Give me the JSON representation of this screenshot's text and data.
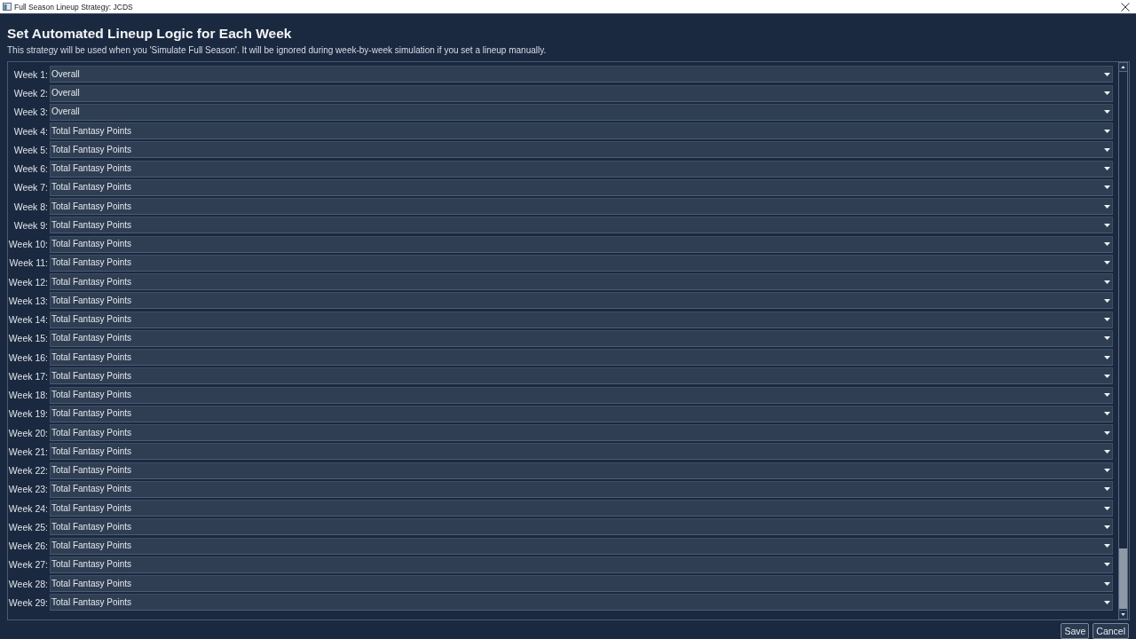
{
  "window": {
    "title": "Full Season Lineup Strategy: JCDS"
  },
  "heading": "Set Automated Lineup Logic for Each Week",
  "description": "This strategy will be used when you 'Simulate Full Season'. It will be ignored during week-by-week simulation if you set a lineup manually.",
  "weeks": [
    {
      "label": "Week 1:",
      "value": "Overall"
    },
    {
      "label": "Week 2:",
      "value": "Overall"
    },
    {
      "label": "Week 3:",
      "value": "Overall"
    },
    {
      "label": "Week 4:",
      "value": "Total Fantasy Points"
    },
    {
      "label": "Week 5:",
      "value": "Total Fantasy Points"
    },
    {
      "label": "Week 6:",
      "value": "Total Fantasy Points"
    },
    {
      "label": "Week 7:",
      "value": "Total Fantasy Points"
    },
    {
      "label": "Week 8:",
      "value": "Total Fantasy Points"
    },
    {
      "label": "Week 9:",
      "value": "Total Fantasy Points"
    },
    {
      "label": "Week 10:",
      "value": "Total Fantasy Points"
    },
    {
      "label": "Week 11:",
      "value": "Total Fantasy Points"
    },
    {
      "label": "Week 12:",
      "value": "Total Fantasy Points"
    },
    {
      "label": "Week 13:",
      "value": "Total Fantasy Points"
    },
    {
      "label": "Week 14:",
      "value": "Total Fantasy Points"
    },
    {
      "label": "Week 15:",
      "value": "Total Fantasy Points"
    },
    {
      "label": "Week 16:",
      "value": "Total Fantasy Points"
    },
    {
      "label": "Week 17:",
      "value": "Total Fantasy Points"
    },
    {
      "label": "Week 18:",
      "value": "Total Fantasy Points"
    },
    {
      "label": "Week 19:",
      "value": "Total Fantasy Points"
    },
    {
      "label": "Week 20:",
      "value": "Total Fantasy Points"
    },
    {
      "label": "Week 21:",
      "value": "Total Fantasy Points"
    },
    {
      "label": "Week 22:",
      "value": "Total Fantasy Points"
    },
    {
      "label": "Week 23:",
      "value": "Total Fantasy Points"
    },
    {
      "label": "Week 24:",
      "value": "Total Fantasy Points"
    },
    {
      "label": "Week 25:",
      "value": "Total Fantasy Points"
    },
    {
      "label": "Week 26:",
      "value": "Total Fantasy Points"
    },
    {
      "label": "Week 27:",
      "value": "Total Fantasy Points"
    },
    {
      "label": "Week 28:",
      "value": "Total Fantasy Points"
    },
    {
      "label": "Week 29:",
      "value": "Total Fantasy Points"
    }
  ],
  "buttons": [
    {
      "label": "Save"
    },
    {
      "label": "Cancel"
    }
  ]
}
